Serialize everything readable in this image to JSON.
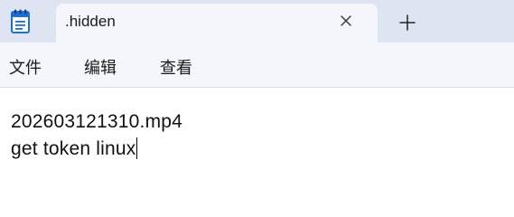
{
  "tab": {
    "title": ".hidden"
  },
  "icons": {
    "app": "notepad-icon",
    "close": "close-icon",
    "new_tab": "plus-icon"
  },
  "menu": {
    "items": [
      "文件",
      "编辑",
      "查看"
    ]
  },
  "editor": {
    "lines": [
      "202603121310.mp4",
      "get token linux"
    ]
  },
  "colors": {
    "titlebar": "#dfe4f2",
    "tab": "#f4f6fc",
    "editor_bg": "#ffffff",
    "icon_blue": "#1c6fd1"
  }
}
